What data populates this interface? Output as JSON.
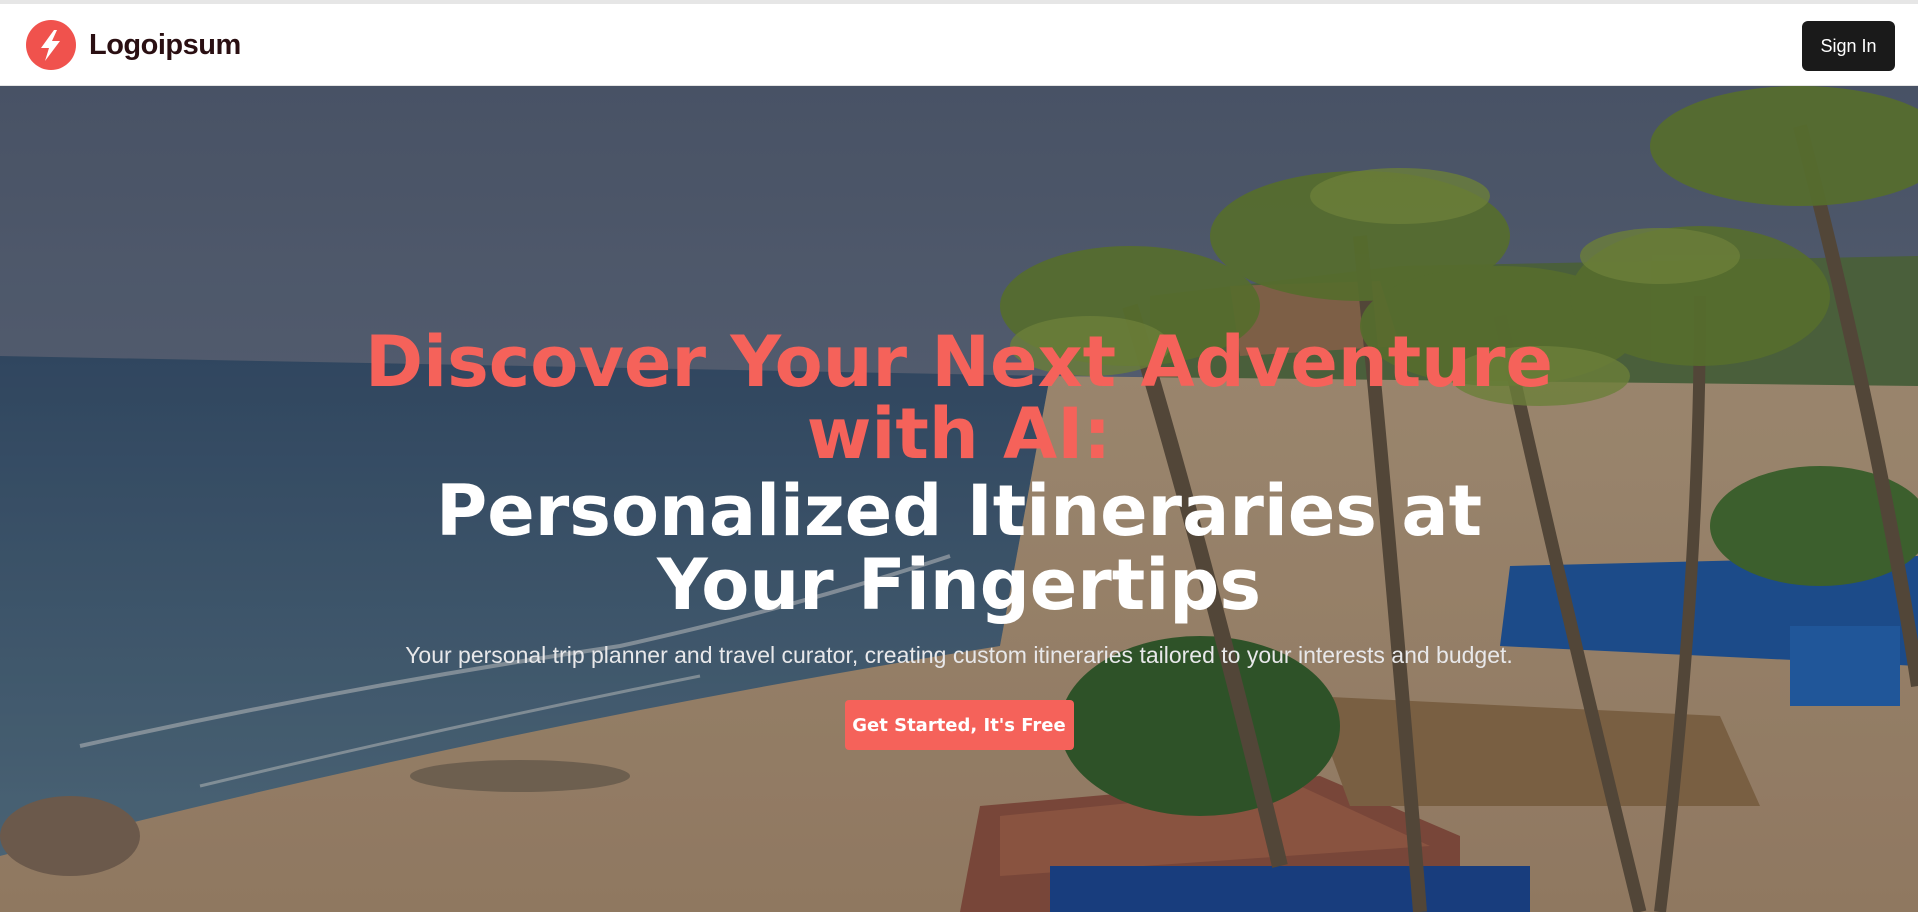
{
  "header": {
    "logo_text": "Logoipsum",
    "logo_icon": "lightning-bolt-icon",
    "sign_in_label": "Sign In"
  },
  "hero": {
    "background_image": "tropical beach with palm trees and huts",
    "headline_accent": "Discover Your Next Adventure with AI:",
    "headline_main": "Personalized Itineraries at Your Fingertips",
    "subtitle": "Your personal trip planner and travel curator, creating custom itineraries tailored to your interests and budget.",
    "cta_label": "Get Started, It's Free"
  },
  "colors": {
    "accent": "#f5625a",
    "sign_in_bg": "#1a1a1a",
    "logo_text": "#2a0f12"
  }
}
